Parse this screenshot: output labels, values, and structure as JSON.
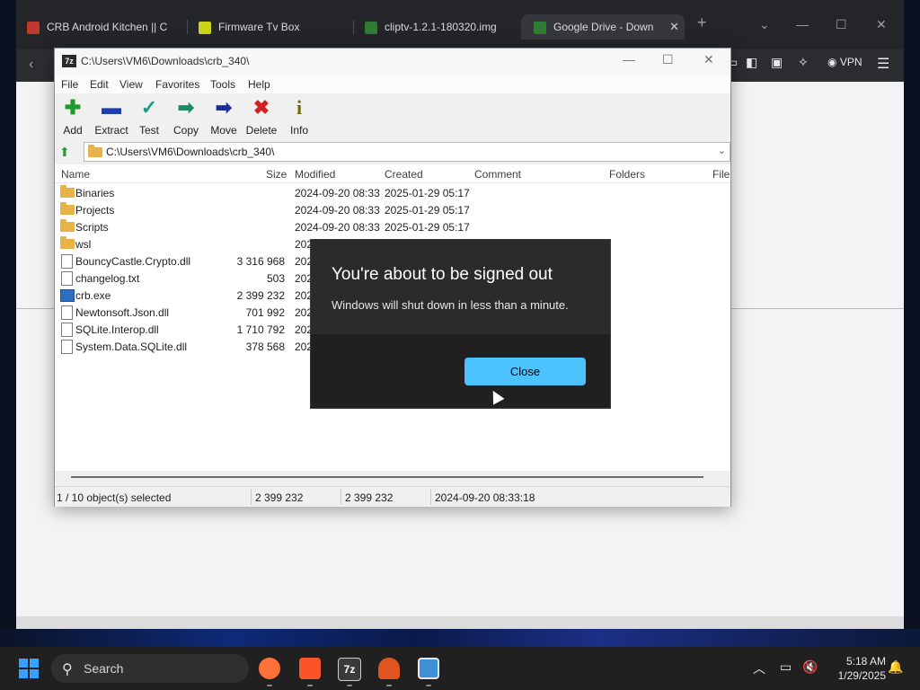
{
  "browser": {
    "tabs": [
      {
        "label": "CRB Android Kitchen || C",
        "icon": "crb-icon",
        "color": "#c0392b"
      },
      {
        "label": "Firmware Tv Box",
        "icon": "firmware-icon",
        "color": "#c8d41a"
      },
      {
        "label": "cliptv-1.2.1-180320.img",
        "icon": "google-drive-icon",
        "color": "#2e7d32"
      },
      {
        "label": "Google Drive - Down",
        "icon": "google-drive-icon",
        "color": "#2e7d32"
      }
    ],
    "vpn_label": "VPN"
  },
  "zip": {
    "title": "C:\\Users\\VM6\\Downloads\\crb_340\\",
    "logo": "7z",
    "menu": [
      "File",
      "Edit",
      "View",
      "Favorites",
      "Tools",
      "Help"
    ],
    "toolbar": [
      {
        "label": "Add",
        "icon": "plus-icon",
        "glyph": "✚",
        "color": "#1f9a2a"
      },
      {
        "label": "Extract",
        "icon": "minus-icon",
        "glyph": "▬",
        "color": "#1f3fb0"
      },
      {
        "label": "Test",
        "icon": "check-icon",
        "glyph": "✓",
        "color": "#1a9a8a"
      },
      {
        "label": "Copy",
        "icon": "copy-arrow-icon",
        "glyph": "➡",
        "color": "#1a8a6a"
      },
      {
        "label": "Move",
        "icon": "move-arrow-icon",
        "glyph": "➡",
        "color": "#1a2f9a"
      },
      {
        "label": "Delete",
        "icon": "delete-x-icon",
        "glyph": "✖",
        "color": "#d42020"
      },
      {
        "label": "Info",
        "icon": "info-icon",
        "glyph": "i",
        "color": "#6b6b10"
      }
    ],
    "path": "C:\\Users\\VM6\\Downloads\\crb_340\\",
    "columns": [
      "Name",
      "Size",
      "Modified",
      "Created",
      "Comment",
      "Folders",
      "File"
    ],
    "rows": [
      {
        "name": "Binaries",
        "size": "",
        "modified": "2024-09-20 08:33",
        "created": "2025-01-29 05:17",
        "type": "folder"
      },
      {
        "name": "Projects",
        "size": "",
        "modified": "2024-09-20 08:33",
        "created": "2025-01-29 05:17",
        "type": "folder"
      },
      {
        "name": "Scripts",
        "size": "",
        "modified": "2024-09-20 08:33",
        "created": "2025-01-29 05:17",
        "type": "folder"
      },
      {
        "name": "wsl",
        "size": "",
        "modified": "202",
        "created": "",
        "type": "folder"
      },
      {
        "name": "BouncyCastle.Crypto.dll",
        "size": "3 316 968",
        "modified": "202",
        "created": "",
        "type": "file"
      },
      {
        "name": "changelog.txt",
        "size": "503",
        "modified": "202",
        "created": "",
        "type": "file"
      },
      {
        "name": "crb.exe",
        "size": "2 399 232",
        "modified": "202",
        "created": "",
        "type": "exe"
      },
      {
        "name": "Newtonsoft.Json.dll",
        "size": "701 992",
        "modified": "202",
        "created": "",
        "type": "file"
      },
      {
        "name": "SQLite.Interop.dll",
        "size": "1 710 792",
        "modified": "202",
        "created": "",
        "type": "file"
      },
      {
        "name": "System.Data.SQLite.dll",
        "size": "378 568",
        "modified": "202",
        "created": "",
        "type": "file"
      }
    ],
    "status": {
      "selected": "1 / 10 object(s) selected",
      "size": "2 399 232",
      "packed": "2 399 232",
      "date": "2024-09-20 08:33:18"
    }
  },
  "dialog": {
    "title": "You're about to be signed out",
    "message": "Windows will shut down in less than a minute.",
    "button": "Close",
    "button_color": "#4cc2ff"
  },
  "taskbar": {
    "search_label": "Search",
    "time": "5:18 AM",
    "date": "1/29/2025",
    "apps": [
      {
        "name": "firefox-icon",
        "glyph": "",
        "color": "#ff7139"
      },
      {
        "name": "brave-icon",
        "glyph": "",
        "color": "#fb542b"
      },
      {
        "name": "7zip-taskbar-icon",
        "glyph": "7z",
        "color": "#3a3a3a"
      },
      {
        "name": "crb-taskbar-icon",
        "glyph": "",
        "color": "#e0551f"
      },
      {
        "name": "window-app-icon",
        "glyph": "",
        "color": "#3d8fd8"
      }
    ]
  }
}
